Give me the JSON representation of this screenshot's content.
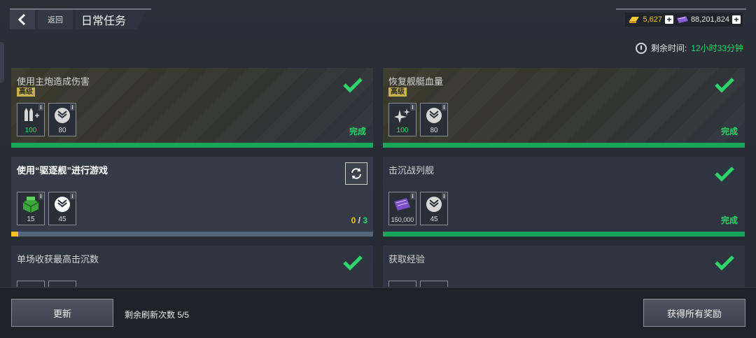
{
  "header": {
    "back_label": "返回",
    "title": "日常任务"
  },
  "currency": {
    "gold": "5,627",
    "gems": "88,201,824"
  },
  "timer": {
    "label": "剩余时间:",
    "value": "12小时33分钟"
  },
  "tasks": [
    {
      "title": "使用主炮造成伤害",
      "badge": "高级",
      "status": "完成",
      "rewards": [
        {
          "amount": "100"
        },
        {
          "amount": "80"
        }
      ]
    },
    {
      "title": "恢复舰艇血量",
      "badge": "高级",
      "status": "完成",
      "rewards": [
        {
          "amount": "100"
        },
        {
          "amount": "80"
        }
      ]
    },
    {
      "title": "使用“驱逐舰”进行游戏",
      "progress_current": "0",
      "progress_sep": "/",
      "progress_total": "3",
      "progress_fraction": 0.02,
      "rewards": [
        {
          "amount": "15"
        },
        {
          "amount": "45"
        }
      ]
    },
    {
      "title": "击沉战列舰",
      "status": "完成",
      "rewards": [
        {
          "amount": "150,000"
        },
        {
          "amount": "45"
        }
      ]
    },
    {
      "title": "单场收获最高击沉数"
    },
    {
      "title": "获取经验"
    }
  ],
  "bottom": {
    "refresh_button": "更新",
    "refresh_count_label": "剩余刷新次数 5/5",
    "claim_all_button": "获得所有奖励"
  },
  "colors": {
    "complete_green": "#18a65a",
    "progress_yellow": "#f2c21c",
    "badge_gold": "#c9b24a"
  }
}
